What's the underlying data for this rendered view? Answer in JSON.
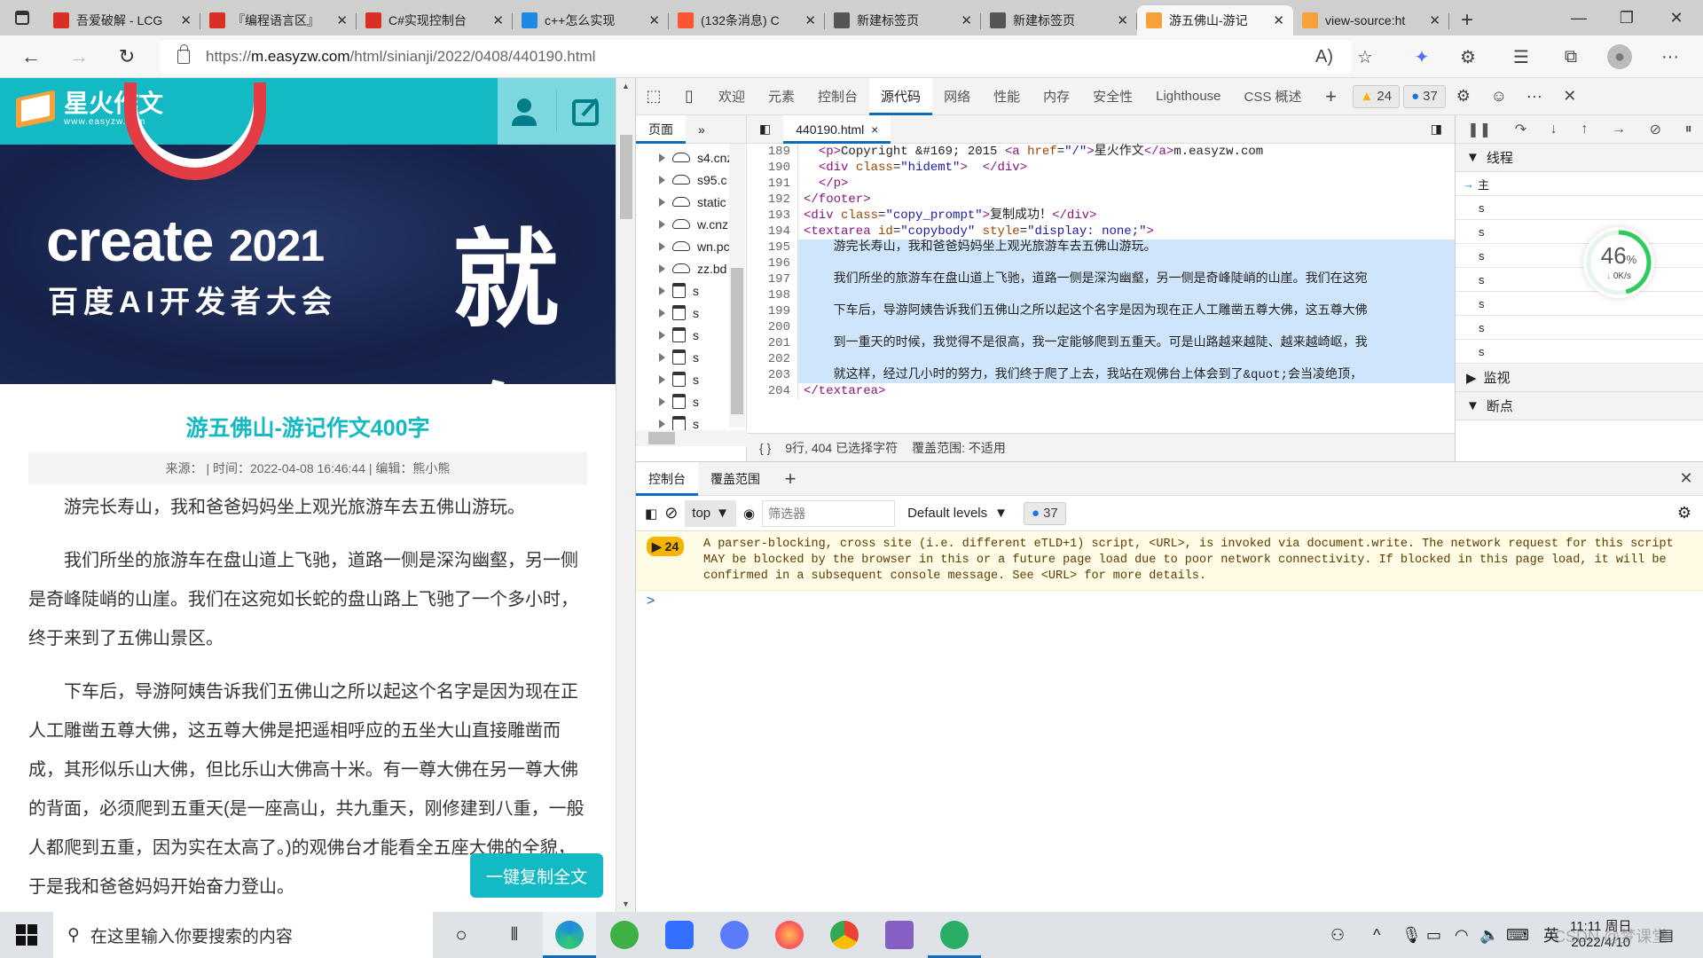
{
  "browser": {
    "tabs": [
      {
        "title": "吾爱破解 - LCG",
        "favicon": "52pojie-icon",
        "color": "#d93025"
      },
      {
        "title": "『编程语言区』",
        "favicon": "52pojie-icon",
        "color": "#d93025"
      },
      {
        "title": "C#实现控制台",
        "favicon": "52pojie-icon",
        "color": "#d93025"
      },
      {
        "title": "c++怎么实现",
        "favicon": "bing-icon",
        "color": "#1e88e5"
      },
      {
        "title": "(132条消息) C",
        "favicon": "csdn-icon",
        "color": "#fc5531"
      },
      {
        "title": "新建标签页",
        "favicon": "new-tab-icon",
        "color": "#555555"
      },
      {
        "title": "新建标签页",
        "favicon": "new-tab-icon",
        "color": "#555555"
      },
      {
        "title": "游五佛山-游记",
        "favicon": "easyzw-icon",
        "color": "#f7a13a",
        "active": true
      },
      {
        "title": "view-source:ht",
        "favicon": "easyzw-icon",
        "color": "#f7a13a"
      }
    ],
    "new_tab": "+",
    "url_prefix": "https://",
    "url_host": "m.easyzw.com",
    "url_path": "/html/sinianji/2022/0408/440190.html"
  },
  "page": {
    "logo_name": "星火作文",
    "logo_sub": "www.easyzw.com",
    "banner_main": "create",
    "banner_year": "2021",
    "banner_sub": "百度AI开发者大会",
    "banner_big": "就在",
    "title": "游五佛山-游记作文400字",
    "meta": "来源：  | 时间：2022-04-08 16:46:44 | 编辑：熊小熊",
    "paragraphs": [
      "游完长寿山，我和爸爸妈妈坐上观光旅游车去五佛山游玩。",
      "我们所坐的旅游车在盘山道上飞驰，道路一侧是深沟幽壑，另一侧是奇峰陡峭的山崖。我们在这宛如长蛇的盘山路上飞驰了一个多小时，终于来到了五佛山景区。",
      "下车后，导游阿姨告诉我们五佛山之所以起这个名字是因为现在正人工雕凿五尊大佛，这五尊大佛是把遥相呼应的五坐大山直接雕凿而成，其形似乐山大佛，但比乐山大佛高十米。有一尊大佛在另一尊大佛的背面，必须爬到五重天(是一座高山，共九重天，刚修建到八重，一般人都爬到五重，因为实在太高了。)的观佛台才能看全五座大佛的全貌，于是我和爸爸妈妈开始奋力登山。",
      "到一重天的时候，我觉得不是很高，我一定能够爬到五重天。可是"
    ],
    "copy_button": "一键复制全文"
  },
  "devtools": {
    "tabs": [
      "欢迎",
      "元素",
      "控制台",
      "源代码",
      "网络",
      "性能",
      "内存",
      "安全性",
      "Lighthouse",
      "CSS 概述"
    ],
    "active_tab": "源代码",
    "warnings_count": "24",
    "messages_count": "37",
    "nav_tab": "页面",
    "tree": [
      {
        "label": "s4.cnz",
        "type": "cloud"
      },
      {
        "label": "s95.c",
        "type": "cloud"
      },
      {
        "label": "static",
        "type": "cloud"
      },
      {
        "label": "w.cnz",
        "type": "cloud"
      },
      {
        "label": "wn.pc",
        "type": "cloud"
      },
      {
        "label": "zz.bd",
        "type": "cloud"
      },
      {
        "label": "s",
        "type": "frame"
      },
      {
        "label": "s",
        "type": "frame"
      },
      {
        "label": "s",
        "type": "frame"
      },
      {
        "label": "s",
        "type": "frame"
      },
      {
        "label": "s",
        "type": "frame"
      },
      {
        "label": "s",
        "type": "frame"
      },
      {
        "label": "s",
        "type": "frame"
      }
    ],
    "file_tab": "440190.html",
    "code_lines": [
      {
        "n": "189",
        "html": "  <span class=\"tg\">&lt;p&gt;</span>Copyright &amp;#169; 2015 <span class=\"tg\">&lt;a</span> <span class=\"at\">href</span>=<span class=\"av\">\"/\"</span><span class=\"tg\">&gt;</span>星火作文<span class=\"tg\">&lt;/a&gt;</span>m.easyzw.com"
      },
      {
        "n": "190",
        "html": "  <span class=\"tg\">&lt;div</span> <span class=\"at\">class</span>=<span class=\"av\">\"hidemt\"</span><span class=\"tg\">&gt;</span>  <span class=\"tg\">&lt;/div&gt;</span>"
      },
      {
        "n": "191",
        "html": "  <span class=\"tg\">&lt;/p&gt;</span>"
      },
      {
        "n": "192",
        "html": "<span class=\"tg\">&lt;/footer&gt;</span>"
      },
      {
        "n": "193",
        "html": "<span class=\"tg\">&lt;div</span> <span class=\"at\">class</span>=<span class=\"av\">\"copy_prompt\"</span><span class=\"tg\">&gt;</span>复制成功！<span class=\"tg\">&lt;/div&gt;</span>"
      },
      {
        "n": "194",
        "html": "<span class=\"tg\">&lt;textarea</span> <span class=\"at\">id</span>=<span class=\"av\">\"copybody\"</span> <span class=\"at\">style</span>=<span class=\"av\">\"display: none;\"</span><span class=\"tg\">&gt;</span>"
      },
      {
        "n": "195",
        "html": "    游完长寿山，我和爸爸妈妈坐上观光旅游车去五佛山游玩。",
        "sel": true
      },
      {
        "n": "196",
        "html": "",
        "sel": true
      },
      {
        "n": "197",
        "html": "    我们所坐的旅游车在盘山道上飞驰，道路一侧是深沟幽壑，另一侧是奇峰陡峭的山崖。我们在这宛",
        "sel": true
      },
      {
        "n": "198",
        "html": "",
        "sel": true
      },
      {
        "n": "199",
        "html": "    下车后，导游阿姨告诉我们五佛山之所以起这个名字是因为现在正人工雕凿五尊大佛，这五尊大佛",
        "sel": true
      },
      {
        "n": "200",
        "html": "",
        "sel": true
      },
      {
        "n": "201",
        "html": "    到一重天的时候，我觉得不是很高，我一定能够爬到五重天。可是山路越来越陡、越来越崎岖，我",
        "sel": true
      },
      {
        "n": "202",
        "html": "",
        "sel": true
      },
      {
        "n": "203",
        "html": "    就这样，经过几小时的努力，我们终于爬了上去，我站在观佛台上体会到了&amp;quot;会当凌绝顶，",
        "sel": true
      },
      {
        "n": "204",
        "html": "<span class=\"tg\">&lt;/textarea&gt;</span>"
      }
    ],
    "status_braces": "{ }",
    "status_selection": "9行, 404 已选择字符",
    "status_coverage": "覆盖范围: 不适用",
    "debugger": {
      "threads_header": "线程",
      "threads": [
        "主",
        "s",
        "s",
        "s",
        "s",
        "s",
        "s",
        "s"
      ],
      "watch_header": "监视",
      "breakpoints_header": "断点"
    },
    "drawer_tabs": [
      "控制台",
      "覆盖范围"
    ],
    "context": "top",
    "filter_placeholder": "筛选器",
    "levels": "Default levels",
    "console_badge": "37",
    "warning_group_count": "24",
    "warning_text": "A parser-blocking, cross site (i.e. different eTLD+1) script, <URL>, is invoked via document.write. The network request for this script MAY be blocked by the browser in this or a future page load due to poor network connectivity. If blocked in this page load, it will be confirmed in a subsequent console message. See <URL> for more details.",
    "prompt": ">"
  },
  "overlay": {
    "percent": 46,
    "percent_label": "46",
    "speed": "0K/s"
  },
  "taskbar": {
    "search_placeholder": "在这里输入你要搜索的内容",
    "ime": "英",
    "time": "11:11 周日",
    "date": "2022/4/10",
    "watermark": "CSDN @梦课堂"
  }
}
